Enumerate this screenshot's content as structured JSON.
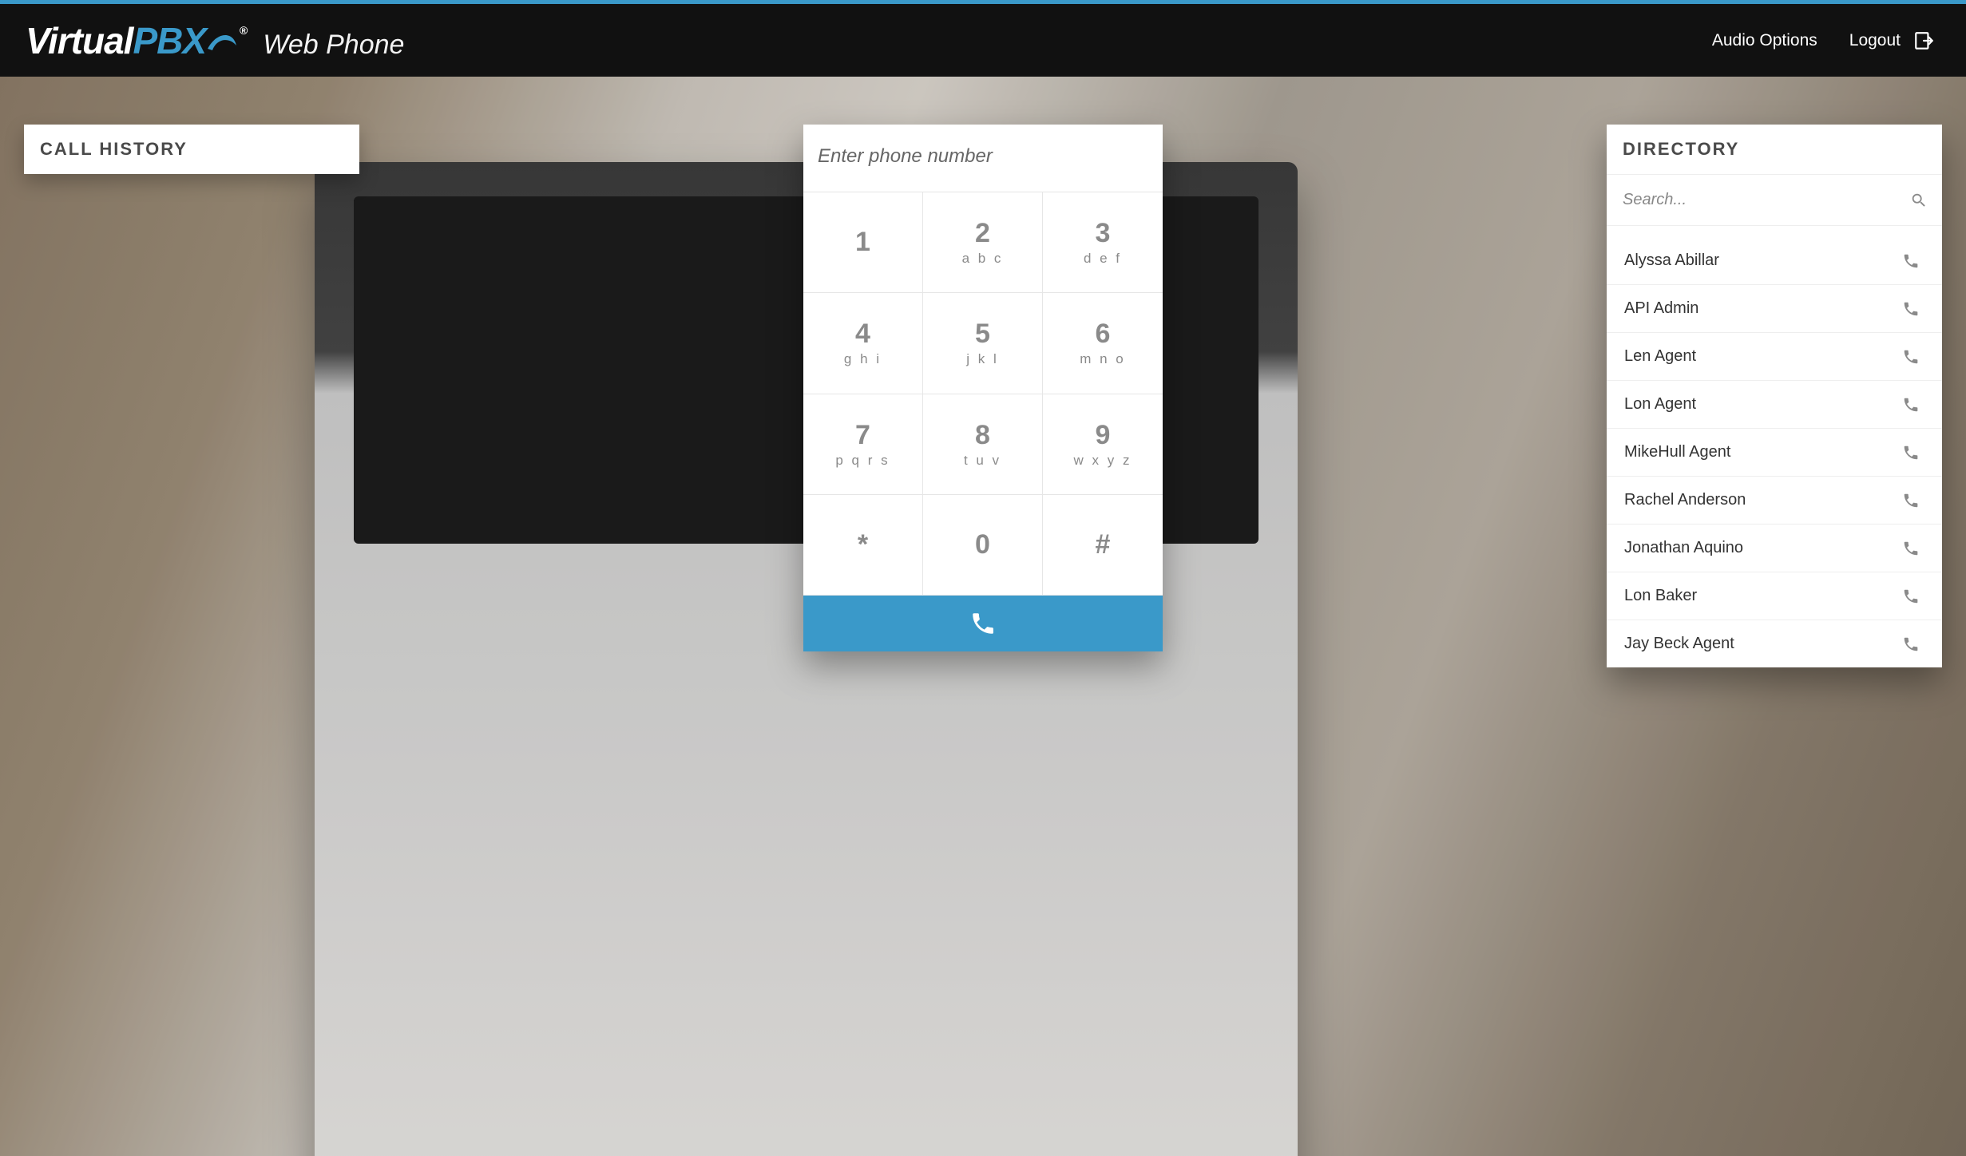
{
  "header": {
    "brand_virtual": "Virtual",
    "brand_pbx": "PBX",
    "subtitle": "Web Phone",
    "audio_options": "Audio Options",
    "logout": "Logout"
  },
  "call_history": {
    "title": "CALL HISTORY"
  },
  "dialer": {
    "placeholder": "Enter phone number",
    "keys": [
      {
        "digit": "1",
        "letters": ""
      },
      {
        "digit": "2",
        "letters": "abc"
      },
      {
        "digit": "3",
        "letters": "def"
      },
      {
        "digit": "4",
        "letters": "ghi"
      },
      {
        "digit": "5",
        "letters": "jkl"
      },
      {
        "digit": "6",
        "letters": "mno"
      },
      {
        "digit": "7",
        "letters": "pqrs"
      },
      {
        "digit": "8",
        "letters": "tuv"
      },
      {
        "digit": "9",
        "letters": "wxyz"
      },
      {
        "digit": "*",
        "letters": ""
      },
      {
        "digit": "0",
        "letters": ""
      },
      {
        "digit": "#",
        "letters": ""
      }
    ]
  },
  "directory": {
    "title": "DIRECTORY",
    "search_placeholder": "Search...",
    "items": [
      {
        "name": "Alyssa Abillar"
      },
      {
        "name": "API Admin"
      },
      {
        "name": "Len Agent"
      },
      {
        "name": "Lon Agent"
      },
      {
        "name": "MikeHull Agent"
      },
      {
        "name": "Rachel Anderson"
      },
      {
        "name": "Jonathan Aquino"
      },
      {
        "name": "Lon Baker"
      },
      {
        "name": "Jay Beck Agent"
      }
    ]
  }
}
